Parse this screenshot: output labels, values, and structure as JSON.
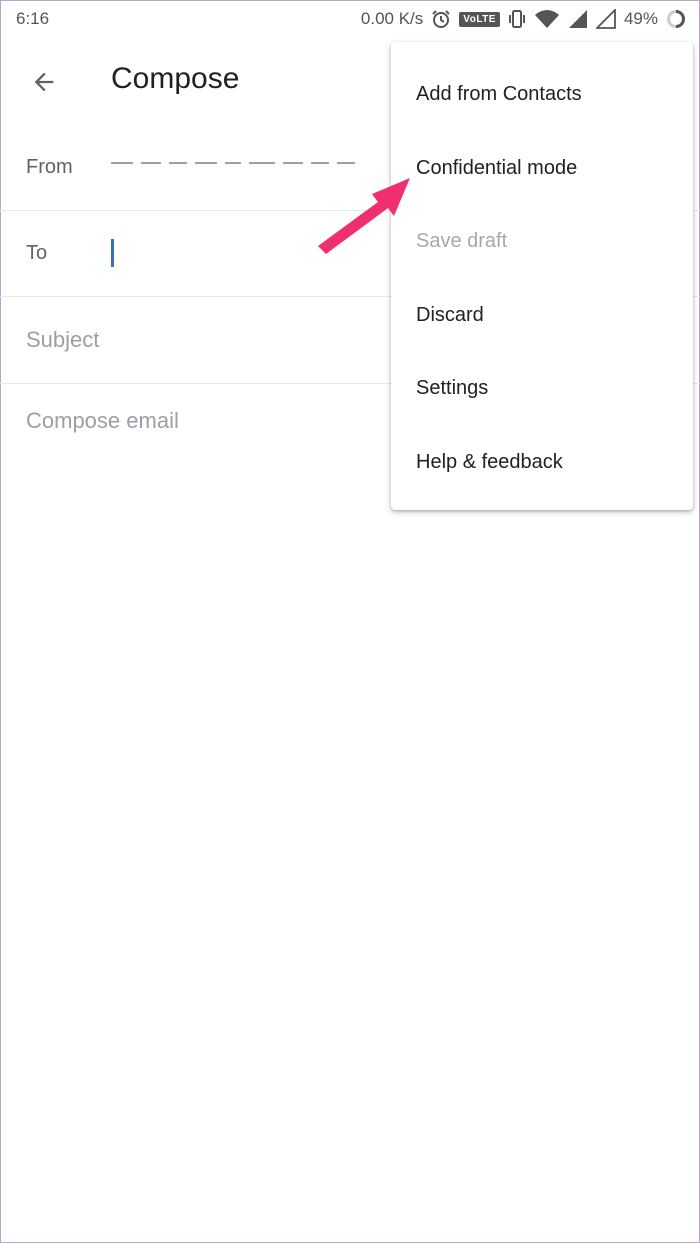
{
  "status_bar": {
    "time": "6:16",
    "net_speed": "0.00 K/s",
    "volte_label": "VoLTE",
    "battery": "49%",
    "icons": [
      "alarm-icon",
      "vibrate-icon",
      "wifi-icon",
      "signal-icon",
      "signal-empty-icon",
      "battery-ring-icon"
    ]
  },
  "app_bar": {
    "title": "Compose",
    "back_icon": "arrow-back-icon"
  },
  "form": {
    "from_label": "From",
    "to_label": "To",
    "subject_placeholder": "Subject",
    "body_placeholder": "Compose email"
  },
  "menu": {
    "items": [
      {
        "label": "Add from Contacts",
        "enabled": true
      },
      {
        "label": "Confidential mode",
        "enabled": true
      },
      {
        "label": "Save draft",
        "enabled": false
      },
      {
        "label": "Discard",
        "enabled": true
      },
      {
        "label": "Settings",
        "enabled": true
      },
      {
        "label": "Help & feedback",
        "enabled": true
      }
    ]
  },
  "colors": {
    "accent": "#3b6fb6",
    "annotation_arrow": "#f0306e",
    "disabled_text": "#a8a8a8"
  }
}
